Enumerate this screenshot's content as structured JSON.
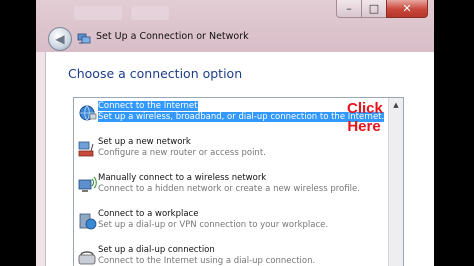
{
  "window": {
    "title": "Set Up a Connection or Network",
    "controls": {
      "minimize": "–",
      "maximize": "□",
      "close": "✕"
    },
    "back_icon": "back-arrow-icon"
  },
  "main": {
    "heading": "Choose a connection option",
    "options": [
      {
        "title": "Connect to the Internet",
        "desc": "Set up a wireless, broadband, or dial-up connection to the Internet.",
        "icon": "globe-network-icon",
        "selected": true
      },
      {
        "title": "Set up a new network",
        "desc": "Configure a new router or access point.",
        "icon": "router-network-icon",
        "selected": false
      },
      {
        "title": "Manually connect to a wireless network",
        "desc": "Connect to a hidden network or create a new wireless profile.",
        "icon": "wireless-computer-icon",
        "selected": false
      },
      {
        "title": "Connect to a workplace",
        "desc": "Set up a dial-up or VPN connection to your workplace.",
        "icon": "workplace-globe-icon",
        "selected": false
      },
      {
        "title": "Set up a dial-up connection",
        "desc": "Connect to the Internet using a dial-up connection.",
        "icon": "phone-modem-icon",
        "selected": false
      }
    ]
  },
  "annotation": {
    "line1": "Click",
    "line2": "Here",
    "color": "#e8141b"
  },
  "colors": {
    "selection": "#3399ff",
    "heading": "#1e3d8a"
  }
}
